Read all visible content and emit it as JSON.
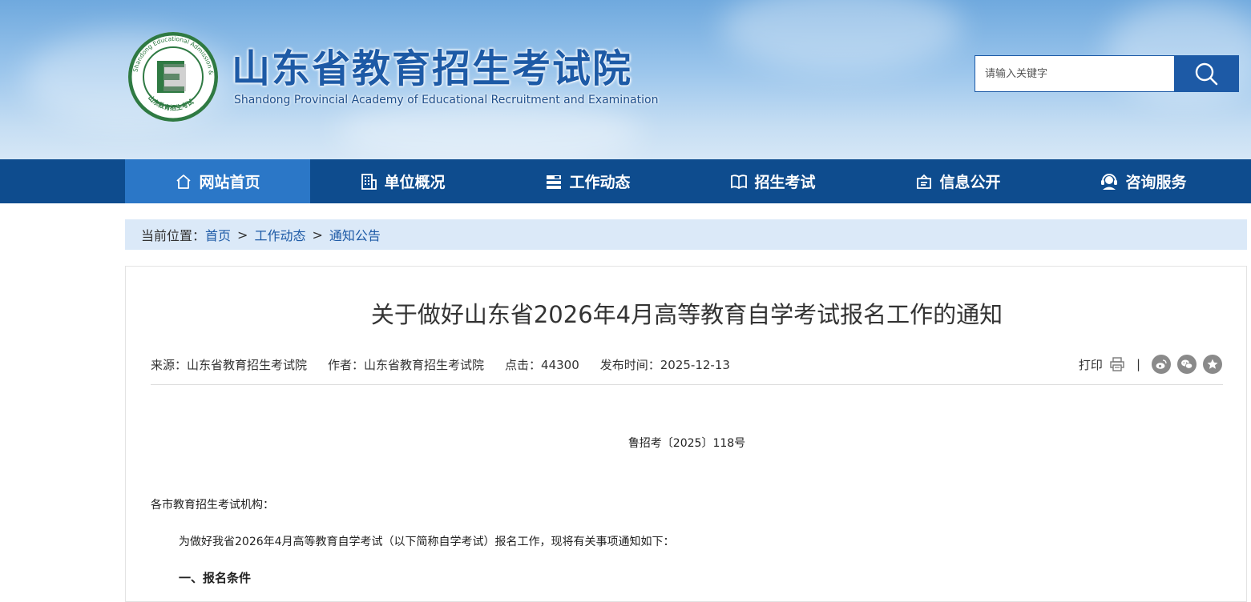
{
  "header": {
    "logo_cn": "山东省教育招生考试院",
    "logo_en": "Shandong Provincial Academy of Educational Recruitment and Examination",
    "emblem_ring_text": "Shandong Educational Admission & Examination",
    "emblem_bottom_text": "山东教育招生考试",
    "emblem_letter": "E"
  },
  "search": {
    "placeholder": "请输入关键字",
    "icon": "search-icon"
  },
  "nav": {
    "items": [
      {
        "label": "网站首页",
        "icon": "home-icon",
        "active": true
      },
      {
        "label": "单位概况",
        "icon": "building-icon"
      },
      {
        "label": "工作动态",
        "icon": "list-icon"
      },
      {
        "label": "招生考试",
        "icon": "book-icon"
      },
      {
        "label": "信息公开",
        "icon": "info-icon"
      },
      {
        "label": "咨询服务",
        "icon": "headset-icon"
      }
    ]
  },
  "breadcrumb": {
    "prefix": "当前位置：",
    "items": [
      "首页",
      "工作动态",
      "通知公告"
    ],
    "separator": ">"
  },
  "article": {
    "title": "关于做好山东省2026年4月高等教育自学考试报名工作的通知",
    "source": "来源：山东省教育招生考试院",
    "author": "作者：山东省教育招生考试院",
    "clicks": "点击：44300",
    "published": "发布时间：2025-12-13",
    "print_label": "打印",
    "tool_sep": "|",
    "doc_number": "鲁招考〔2025〕118号",
    "salutation": "各市教育招生考试机构：",
    "intro": "为做好我省2026年4月高等教育自学考试（以下简称自学考试）报名工作，现将有关事项通知如下：",
    "section1": "一、报名条件"
  },
  "colors": {
    "brand_blue": "#1d5aa6",
    "nav_bg": "#0e4c8e",
    "nav_active": "#2b77c7",
    "breadcrumb_bg": "#dbe9f8",
    "emblem_green": "#2f7a43"
  }
}
